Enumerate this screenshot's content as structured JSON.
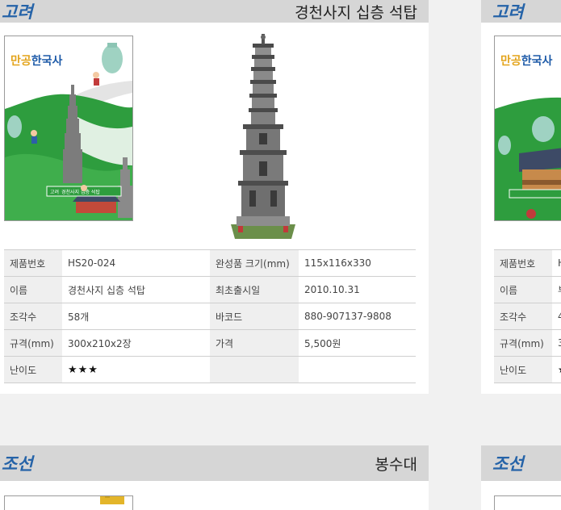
{
  "top_card": {
    "era": "고려",
    "product_name": "경천사지 십층 석탑",
    "book": {
      "brand_accent": "만공",
      "brand_main": "한국사",
      "label_era": "고려",
      "label_name": "경천사지 십층 석탑"
    },
    "specs": [
      {
        "l1": "제품번호",
        "v1": "HS20-024",
        "l2": "완성품 크기(mm)",
        "v2": "115x116x330"
      },
      {
        "l1": "이름",
        "v1": "경천사지 십층 석탑",
        "l2": "최초출시일",
        "v2": "2010.10.31"
      },
      {
        "l1": "조각수",
        "v1": "58개",
        "l2": "바코드",
        "v2": "880-907137-9808"
      },
      {
        "l1": "규격(mm)",
        "v1": "300x210x2장",
        "l2": "가격",
        "v2": "5,500원"
      },
      {
        "l1": "난이도",
        "v1": "★★★",
        "l2": "",
        "v2": ""
      }
    ]
  },
  "right_card": {
    "era": "고려",
    "book": {
      "brand_accent": "만공",
      "brand_main": "한국사"
    },
    "specs": [
      {
        "l1": "제품번호",
        "v1": "H"
      },
      {
        "l1": "이름",
        "v1": "부"
      },
      {
        "l1": "조각수",
        "v1": "4"
      },
      {
        "l1": "규격(mm)",
        "v1": "3"
      },
      {
        "l1": "난이도",
        "v1": "★"
      }
    ]
  },
  "bottom_card": {
    "era": "조선",
    "product_name": "봉수대"
  },
  "bottom_right_card": {
    "era": "조선"
  },
  "difficulty_star_color": "#111111",
  "era_color": "#2563a8"
}
